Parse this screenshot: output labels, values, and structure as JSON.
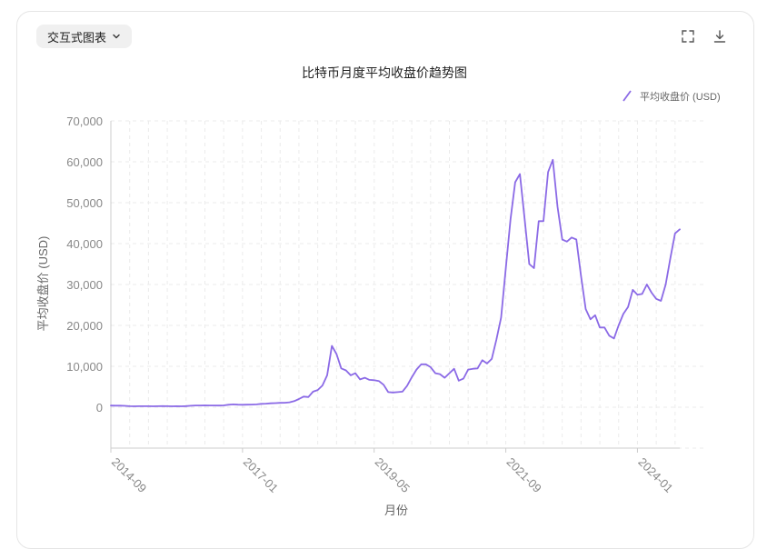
{
  "toolbar": {
    "dropdown_label": "交互式图表",
    "dropdown_icon": "chevron-down-icon",
    "fullscreen_icon": "fullscreen-icon",
    "download_icon": "download-icon"
  },
  "colors": {
    "line": "#8b6ae6",
    "grid": "#ebebeb",
    "axis_text": "#888888",
    "title": "#222222"
  },
  "chart_data": {
    "type": "line",
    "title": "比特币月度平均收盘价趋势图",
    "xlabel": "月份",
    "ylabel": "平均收盘价 (USD)",
    "legend": "平均收盘价 (USD)",
    "legend_position": "top-right",
    "grid": true,
    "x_tick_labels": [
      "2014-09",
      "2017-01",
      "2019-05",
      "2021-09",
      "2024-01"
    ],
    "y_tick_labels": [
      "0",
      "10,000",
      "20,000",
      "30,000",
      "40,000",
      "50,000",
      "60,000",
      "70,000"
    ],
    "ylim": [
      -10000,
      70000
    ],
    "x_start": "2014-09",
    "series": [
      {
        "name": "平均收盘价 (USD)",
        "values": [
          400,
          370,
          380,
          340,
          250,
          230,
          250,
          240,
          240,
          230,
          250,
          260,
          240,
          230,
          240,
          230,
          270,
          360,
          420,
          420,
          440,
          430,
          420,
          410,
          440,
          600,
          680,
          620,
          600,
          630,
          650,
          690,
          830,
          870,
          960,
          1010,
          1060,
          1100,
          1200,
          1500,
          2000,
          2600,
          2500,
          3800,
          4200,
          5300,
          7800,
          15000,
          13000,
          9500,
          9000,
          7800,
          8300,
          6800,
          7200,
          6700,
          6600,
          6400,
          5500,
          3700,
          3600,
          3700,
          3800,
          5200,
          7300,
          9200,
          10500,
          10500,
          9800,
          8300,
          8100,
          7200,
          8300,
          9400,
          6500,
          7000,
          9200,
          9400,
          9500,
          11500,
          10700,
          11800,
          16500,
          21900,
          34000,
          46000,
          55000,
          57000,
          46000,
          35000,
          34000,
          45500,
          45500,
          57500,
          60500,
          49000,
          41000,
          40500,
          41500,
          41000,
          32000,
          24000,
          21500,
          22500,
          19500,
          19500,
          17500,
          16800,
          20000,
          22800,
          24500,
          28700,
          27500,
          27700,
          30000,
          28000,
          26500,
          26000,
          30000,
          36500,
          42500,
          43500
        ]
      }
    ]
  }
}
